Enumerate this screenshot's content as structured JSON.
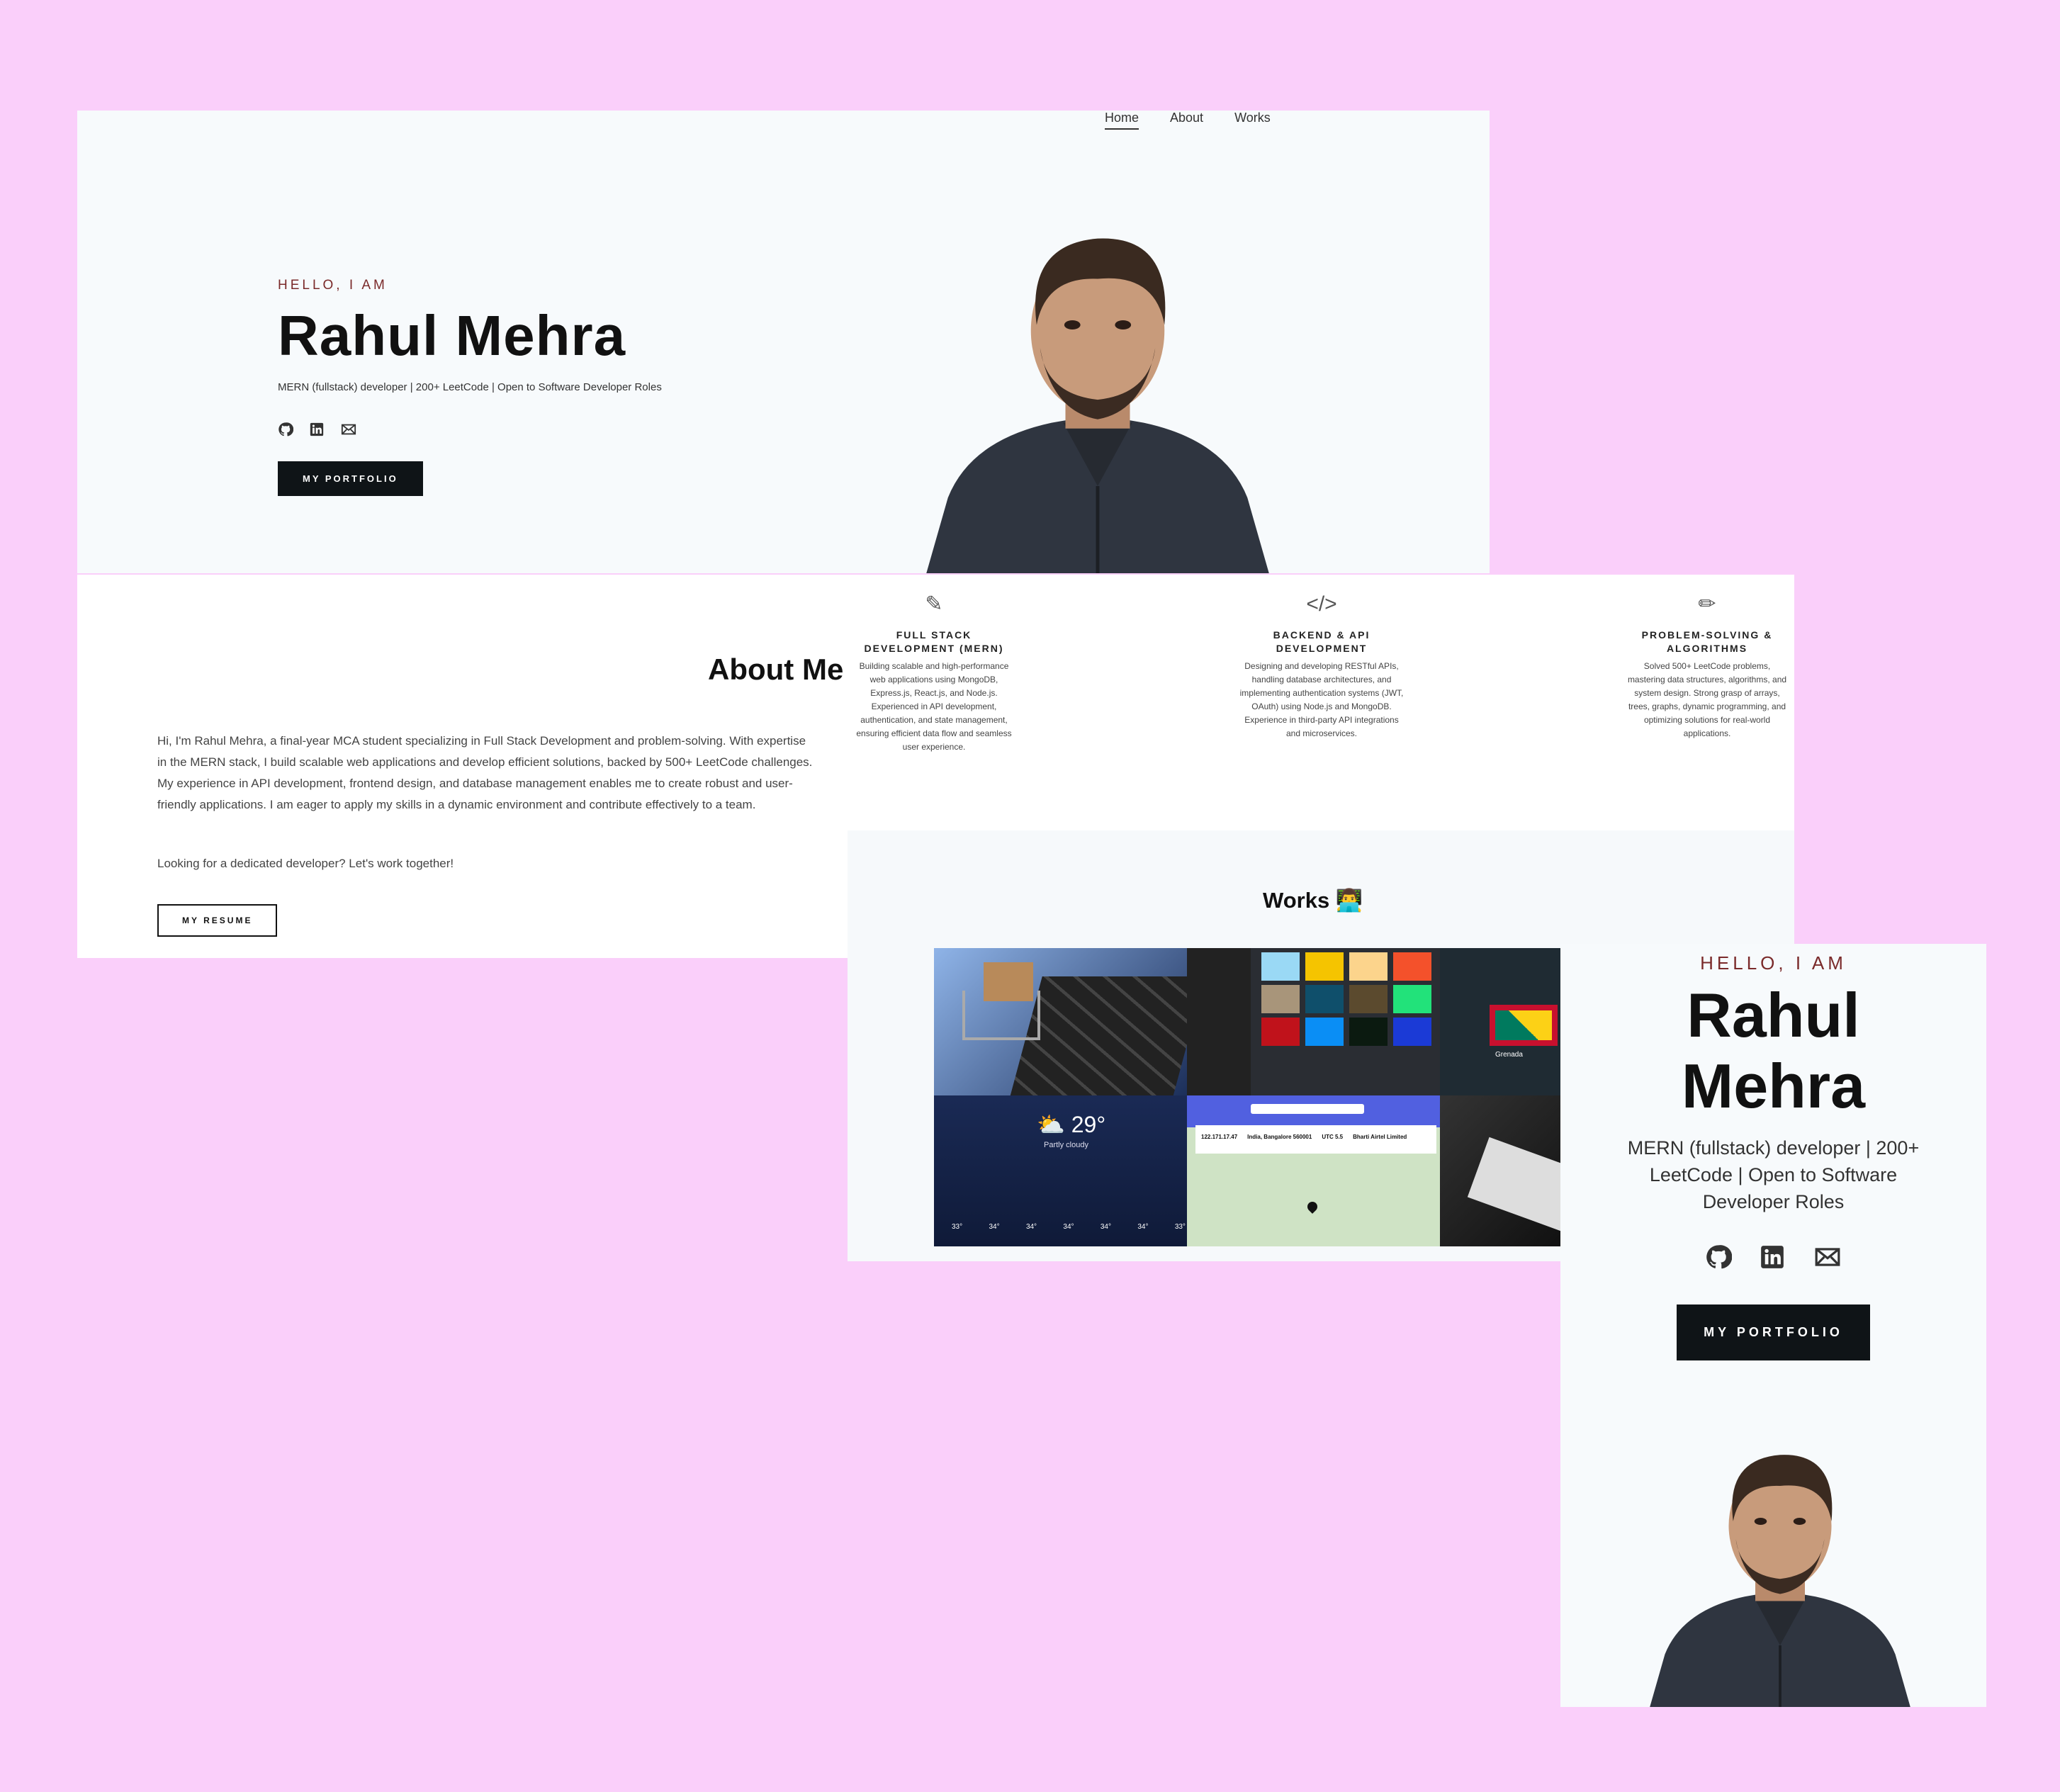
{
  "nav": {
    "items": [
      "Home",
      "About",
      "Works"
    ]
  },
  "hero": {
    "eyebrow": "HELLO, I AM",
    "name": "Rahul Mehra",
    "subtitle": "MERN (fullstack) developer | 200+ LeetCode | Open to Software Developer Roles",
    "portfolio_button": "MY PORTFOLIO",
    "icons": [
      "github-icon",
      "linkedin-icon",
      "mail-icon"
    ]
  },
  "about": {
    "title": "About Me",
    "paragraph": "Hi, I'm Rahul Mehra, a final-year MCA student specializing in Full Stack Development and problem-solving. With expertise in the MERN stack, I build scalable web applications and develop efficient solutions, backed by 500+ LeetCode challenges. My experience in API development, frontend design, and database management enables me to create robust and user-friendly applications. I am eager to apply my skills in a dynamic environment and contribute effectively to a team.",
    "cta": "Looking for a dedicated developer? Let's work together!",
    "resume_button": "MY RESUME"
  },
  "services": [
    {
      "icon": "edit-icon",
      "title": "FULL STACK DEVELOPMENT (MERN)",
      "text": "Building scalable and high-performance web applications using MongoDB, Express.js, React.js, and Node.js. Experienced in API development, authentication, and state management, ensuring efficient data flow and seamless user experience."
    },
    {
      "icon": "code-icon",
      "title": "BACKEND & API DEVELOPMENT",
      "text": "Designing and developing RESTful APIs, handling database architectures, and implementing authentication systems (JWT, OAuth) using Node.js and MongoDB. Experience in third-party API integrations and microservices."
    },
    {
      "icon": "pencil-icon",
      "title": "PROBLEM-SOLVING & ALGORITHMS",
      "text": "Solved 500+ LeetCode problems, mastering data structures, algorithms, and system design. Strong grasp of arrays, trees, graphs, dynamic programming, and optimizing solutions for real-world applications."
    }
  ],
  "works": {
    "title": "Works",
    "weather": {
      "temp": "29°",
      "condition": "Partly cloudy",
      "hours": [
        "33°",
        "34°",
        "34°",
        "34°",
        "34°",
        "34°",
        "33°"
      ]
    },
    "ip": {
      "ip": "122.171.17.47",
      "location": "India, Bangalore 560001",
      "timezone": "UTC 5.5",
      "isp": "Bharti Airtel Limited"
    },
    "country": "Grenada",
    "colors": [
      "#9ad9f5",
      "#f5c400",
      "#fcd48c",
      "#f4512b",
      "#a8957a",
      "#0f4f6b",
      "#5b4a2e",
      "#22e27a",
      "#c0121b",
      "#0a8ef5",
      "#0b1a10",
      "#1b3ad6"
    ]
  },
  "mobile": {
    "eyebrow": "HELLO, I AM",
    "name_line1": "Rahul",
    "name_line2": "Mehra",
    "subtitle": "MERN (fullstack) developer | 200+ LeetCode | Open to Software Developer Roles",
    "portfolio_button": "MY PORTFOLIO"
  }
}
